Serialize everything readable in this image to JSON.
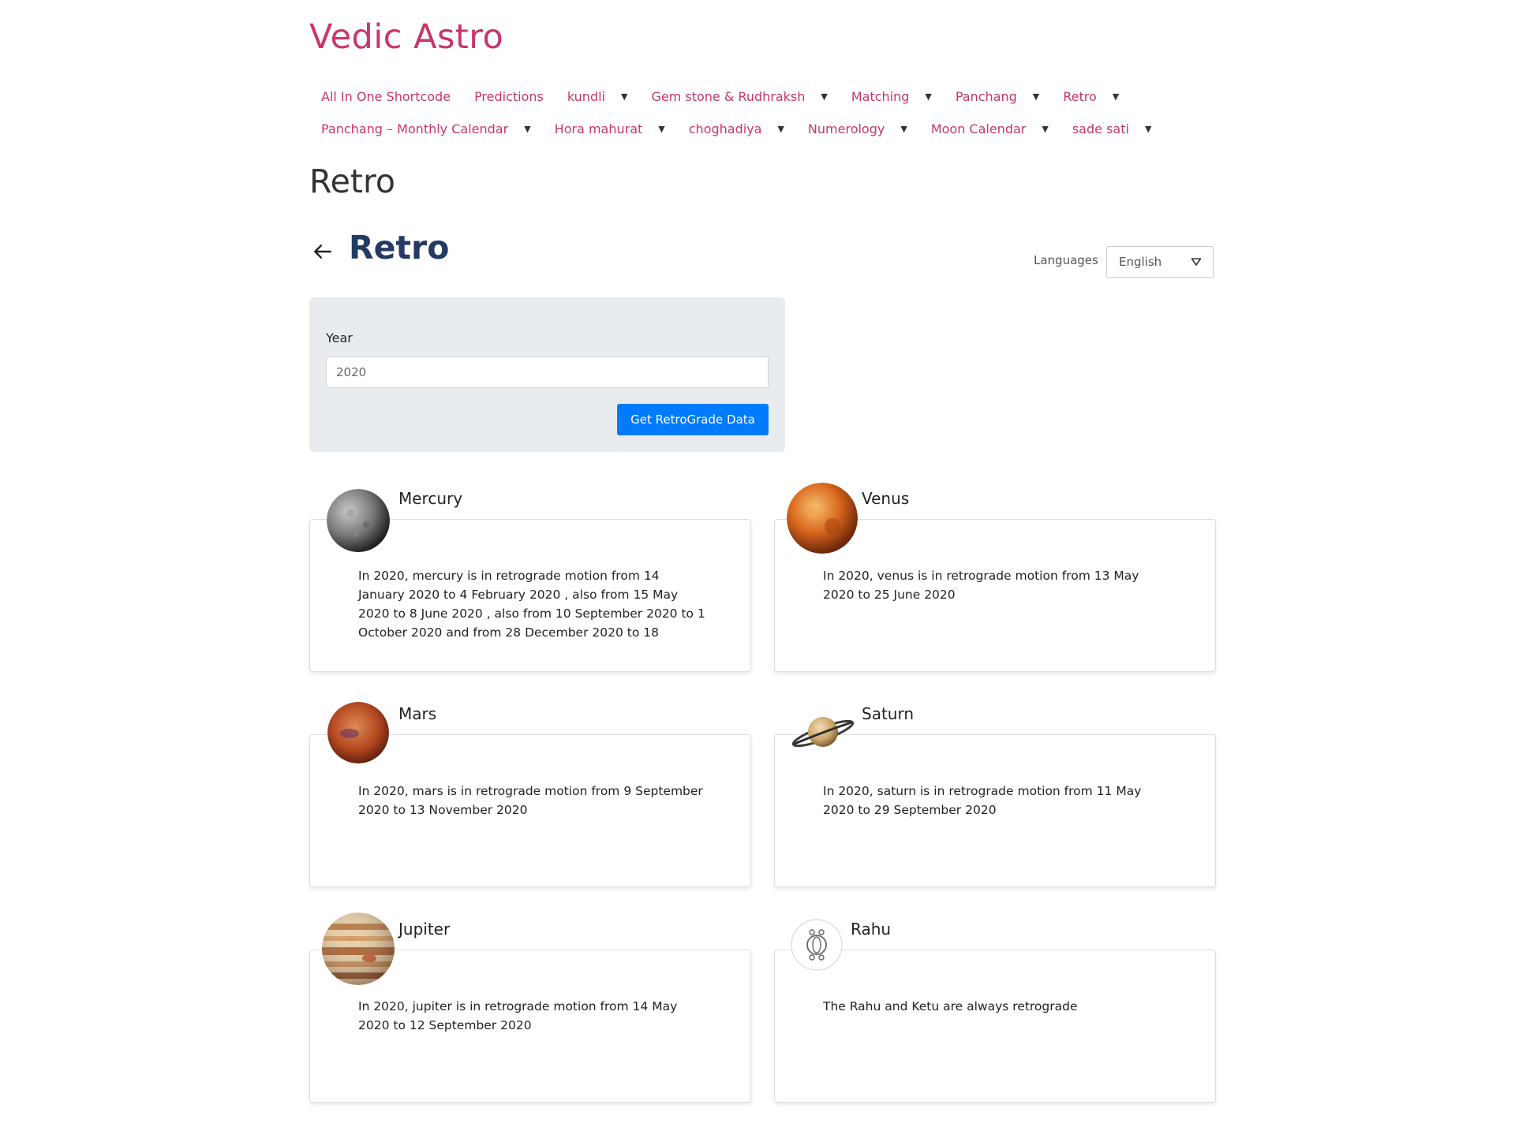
{
  "site": {
    "title": "Vedic Astro"
  },
  "nav": {
    "row1": [
      {
        "label": "All In One Shortcode",
        "caret": false
      },
      {
        "label": "Predictions",
        "caret": false
      },
      {
        "label": "kundli",
        "caret": true
      },
      {
        "label": "Gem stone & Rudhraksh",
        "caret": true
      },
      {
        "label": "Matching",
        "caret": true
      },
      {
        "label": "Panchang",
        "caret": true
      },
      {
        "label": "Retro",
        "caret": true
      }
    ],
    "row2": [
      {
        "label": "Panchang – Monthly Calendar",
        "caret": true
      },
      {
        "label": "Hora mahurat",
        "caret": true
      },
      {
        "label": "choghadiya",
        "caret": true
      },
      {
        "label": "Numerology",
        "caret": true
      },
      {
        "label": "Moon Calendar",
        "caret": true
      },
      {
        "label": "sade sati",
        "caret": true
      }
    ],
    "caret_glyph": "▼"
  },
  "page": {
    "heading": "Retro"
  },
  "section": {
    "title": "Retro",
    "languages_label": "Languages",
    "language_selected": "English"
  },
  "form": {
    "year_label": "Year",
    "year_value": "2020",
    "submit_label": "Get RetroGrade Data"
  },
  "planets": [
    {
      "name": "Mercury",
      "text": "In 2020, mercury is in retrograde motion from 14 January 2020 to 4 February 2020 , also from 15 May 2020 to 8 June 2020 , also from 10 September 2020 to 1 October 2020 and from 28 December 2020 to 18"
    },
    {
      "name": "Venus",
      "text": "In 2020, venus is in retrograde motion from 13 May 2020 to 25 June 2020"
    },
    {
      "name": "Mars",
      "text": "In 2020, mars is in retrograde motion from 9 September 2020 to 13 November 2020"
    },
    {
      "name": "Saturn",
      "text": "In 2020, saturn is in retrograde motion from 11 May 2020 to 29 September 2020"
    },
    {
      "name": "Jupiter",
      "text": "In 2020, jupiter is in retrograde motion from 14 May 2020 to 12 September 2020"
    },
    {
      "name": "Rahu",
      "text": "The Rahu and Ketu are always retrograde"
    }
  ],
  "colors": {
    "brand": "#c9356c",
    "heading_blue": "#243a63",
    "button": "#007bff",
    "panel": "#e9ecef"
  }
}
